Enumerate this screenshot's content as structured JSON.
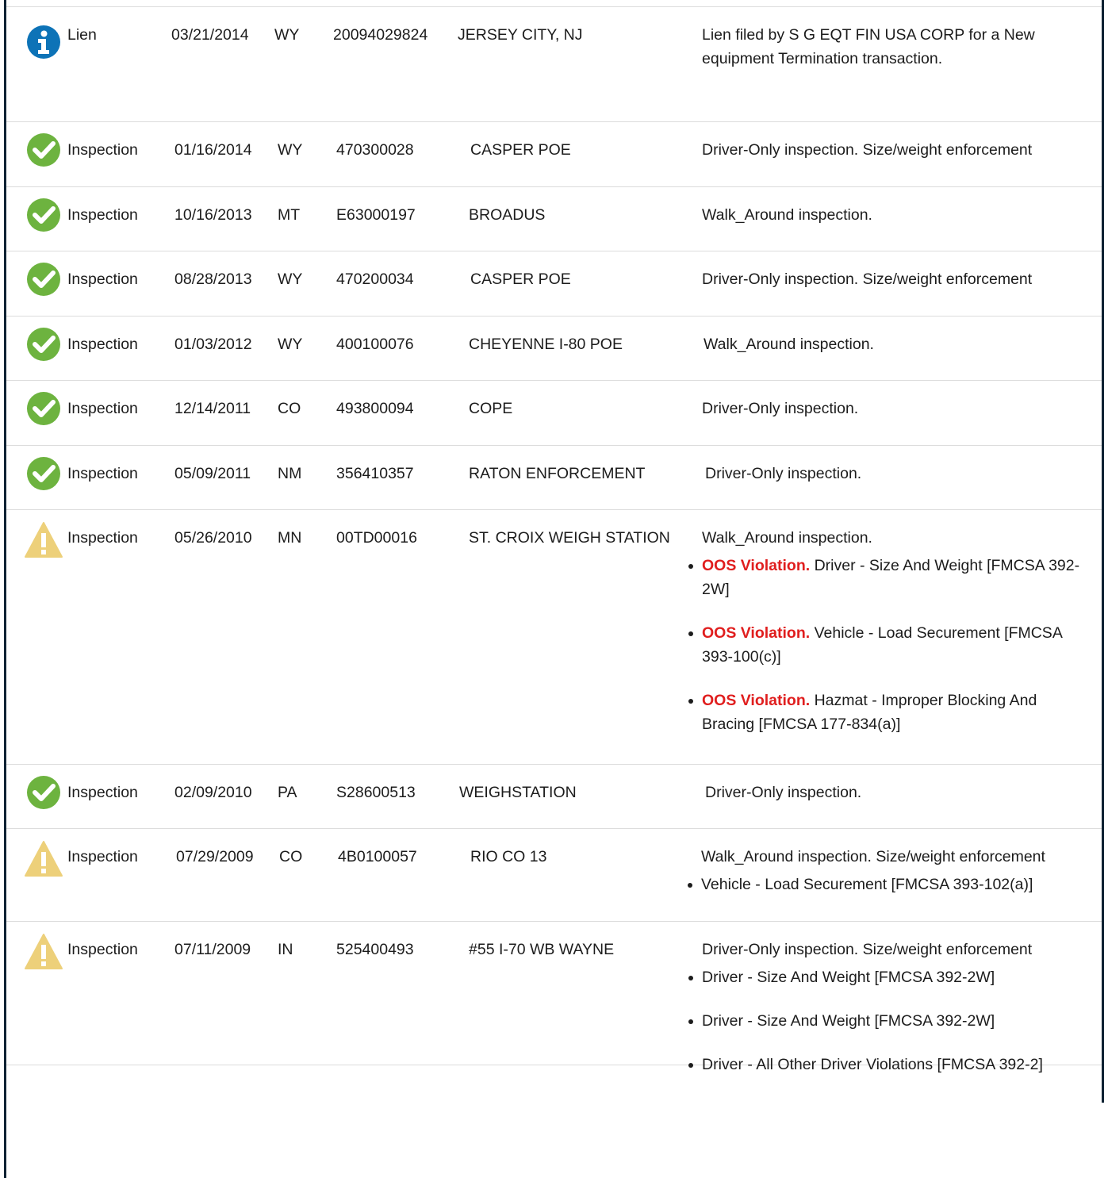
{
  "colors": {
    "frame": "#0f2233",
    "divider": "#dcdcdc",
    "info_icon": "#0d73b7",
    "ok_icon": "#6db33f",
    "warn_icon": "#edd07a",
    "oos_text": "#e01e1e"
  },
  "records": [
    {
      "icon": "info-icon",
      "type": "Lien",
      "date": "03/21/2014",
      "state": "WY",
      "number": "20094029824",
      "location": "JERSEY CITY, NJ",
      "description": "Lien filed by S G EQT FIN USA CORP for a New equipment Termination transaction.",
      "violations": []
    },
    {
      "icon": "check-icon",
      "type": "Inspection",
      "date": "01/16/2014",
      "state": "WY",
      "number": "470300028",
      "location": "CASPER POE",
      "description": "Driver-Only inspection. Size/weight enforcement",
      "violations": []
    },
    {
      "icon": "check-icon",
      "type": "Inspection",
      "date": "10/16/2013",
      "state": "MT",
      "number": "E63000197",
      "location": "BROADUS",
      "description": "Walk_Around inspection.",
      "violations": []
    },
    {
      "icon": "check-icon",
      "type": "Inspection",
      "date": "08/28/2013",
      "state": "WY",
      "number": "470200034",
      "location": "CASPER POE",
      "description": "Driver-Only inspection. Size/weight enforcement",
      "violations": []
    },
    {
      "icon": "check-icon",
      "type": "Inspection",
      "date": "01/03/2012",
      "state": "WY",
      "number": "400100076",
      "location": "CHEYENNE I-80 POE",
      "description": "Walk_Around inspection.",
      "violations": []
    },
    {
      "icon": "check-icon",
      "type": "Inspection",
      "date": "12/14/2011",
      "state": "CO",
      "number": "493800094",
      "location": "COPE",
      "description": "Driver-Only inspection.",
      "violations": []
    },
    {
      "icon": "check-icon",
      "type": "Inspection",
      "date": "05/09/2011",
      "state": "NM",
      "number": "356410357",
      "location": "RATON ENFORCEMENT",
      "description": "Driver-Only inspection.",
      "violations": []
    },
    {
      "icon": "warning-icon",
      "type": "Inspection",
      "date": "05/26/2010",
      "state": "MN",
      "number": "00TD00016",
      "location": "ST. CROIX WEIGH STATION",
      "description": "Walk_Around inspection.",
      "violations": [
        {
          "prefix": "OOS Violation.",
          "text": "Driver - Size And Weight [FMCSA 392-2W]"
        },
        {
          "prefix": "OOS Violation.",
          "text": "Vehicle - Load Securement [FMCSA 393-100(c)]"
        },
        {
          "prefix": "OOS Violation.",
          "text": "Hazmat - Improper Blocking And Bracing [FMCSA 177-834(a)]"
        }
      ]
    },
    {
      "icon": "check-icon",
      "type": "Inspection",
      "date": "02/09/2010",
      "state": "PA",
      "number": "S28600513",
      "location": "WEIGHSTATION",
      "description": "Driver-Only inspection.",
      "violations": []
    },
    {
      "icon": "warning-icon",
      "type": "Inspection",
      "date": "07/29/2009",
      "state": "CO",
      "number": "4B0100057",
      "location": "RIO CO 13",
      "description": "Walk_Around inspection. Size/weight enforcement",
      "violations": [
        {
          "prefix": "",
          "text": "Vehicle - Load Securement [FMCSA 393-102(a)]"
        }
      ]
    },
    {
      "icon": "warning-icon",
      "type": "Inspection",
      "date": "07/11/2009",
      "state": "IN",
      "number": "525400493",
      "location": "#55 I-70 WB WAYNE",
      "description": "Driver-Only inspection. Size/weight enforcement",
      "violations": [
        {
          "prefix": "",
          "text": "Driver - Size And Weight [FMCSA 392-2W]"
        },
        {
          "prefix": "",
          "text": "Driver - Size And Weight [FMCSA 392-2W]"
        },
        {
          "prefix": "",
          "text": "Driver - All Other Driver Violations [FMCSA 392-2]"
        }
      ]
    }
  ]
}
